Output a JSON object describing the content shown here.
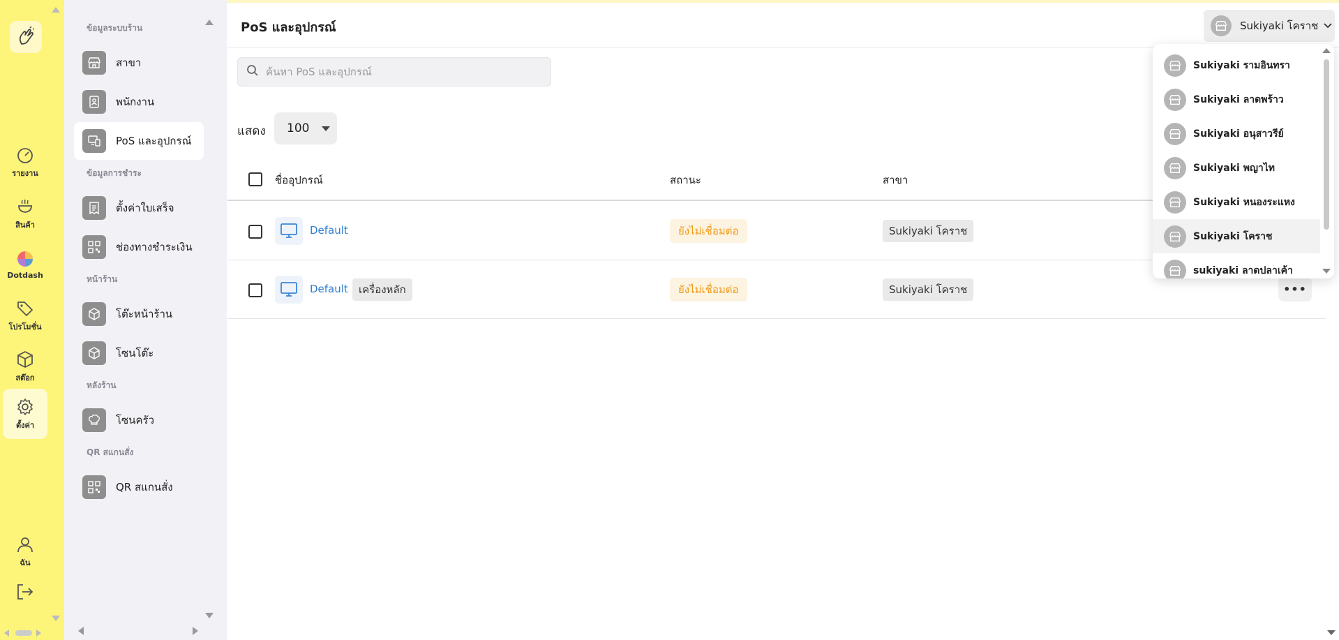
{
  "rail": {
    "items": [
      {
        "label": "รายงาน",
        "icon": "gauge-icon"
      },
      {
        "label": "สินค้า",
        "icon": "bowl-icon"
      },
      {
        "label": "Dotdash",
        "icon": "color-wheel-icon"
      },
      {
        "label": "โปรโมชั่น",
        "icon": "tag-icon"
      },
      {
        "label": "สต๊อก",
        "icon": "box-icon"
      },
      {
        "label": "ตั้งค่า",
        "icon": "gear-icon"
      },
      {
        "label": "ฉัน",
        "icon": "user-icon"
      }
    ]
  },
  "sidebar": {
    "sections": {
      "shop_info": "ข้อมูลระบบร้าน",
      "payment_info": "ข้อมูลการชำระ",
      "front_store": "หน้าร้าน",
      "back_store": "หลังร้าน",
      "qr_order": "QR สแกนสั่ง"
    },
    "items": {
      "branch": "สาขา",
      "staff": "พนักงาน",
      "pos": "PoS และอุปกรณ์",
      "receipt": "ตั้งค่าใบเสร็จ",
      "payment_channel": "ช่องทางชำระเงิน",
      "table": "โต๊ะหน้าร้าน",
      "table_zone": "โซนโต๊ะ",
      "kitchen_zone": "โซนครัว",
      "qr_order": "QR สแกนสั่ง"
    }
  },
  "header": {
    "title": "PoS และอุปกรณ์",
    "branch_selected": "Sukiyaki โคราช"
  },
  "search": {
    "placeholder": "ค้นหา PoS และอุปกรณ์"
  },
  "pagination": {
    "show_label": "แสดง",
    "per_page": "100"
  },
  "table": {
    "columns": {
      "name": "ชื่ออุปกรณ์",
      "status": "สถานะ",
      "branch": "สาขา"
    },
    "rows": [
      {
        "name": "Default",
        "tag": "",
        "status": "ยังไม่เชื่อมต่อ",
        "branch": "Sukiyaki โคราช"
      },
      {
        "name": "Default",
        "tag": "เครื่องหลัก",
        "status": "ยังไม่เชื่อมต่อ",
        "branch": "Sukiyaki โคราช"
      }
    ],
    "more_label": "•••"
  },
  "dropdown": {
    "options": [
      "Sukiyaki รามอินทรา",
      "Sukiyaki ลาดพร้าว",
      "Sukiyaki อนุสาวรีย์",
      "Sukiyaki พญาไท",
      "Sukiyaki หนองระแหง",
      "Sukiyaki โคราช",
      "sukiyaki ลาดปลาเค้า"
    ],
    "selected_index": 5
  },
  "colors": {
    "rail_bg": "#fdf47a",
    "link": "#2e7fd0",
    "status_warn": "#ef9a16"
  }
}
